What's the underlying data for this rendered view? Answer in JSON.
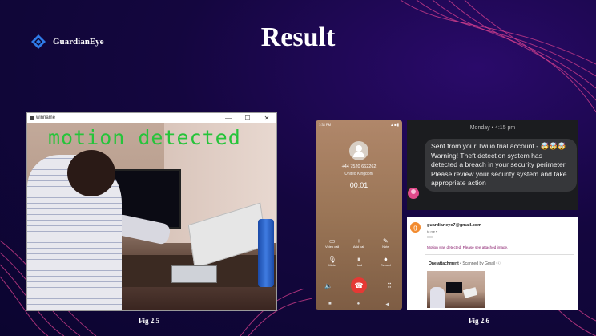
{
  "brand": {
    "name": "GuardianEye",
    "color": "#2f7be8"
  },
  "slide": {
    "title": "Result"
  },
  "fig25": {
    "caption": "Fig 2.5",
    "window_title": "winname",
    "overlay_text": "motion detected",
    "overlay_color": "#26c43a",
    "window_controls": {
      "minimize": "—",
      "maximize": "☐",
      "close": "✕"
    }
  },
  "fig26": {
    "caption": "Fig 2.6",
    "call": {
      "status_time": "1:34 PM",
      "status_icons": "▲ ■ ▮",
      "number": "+44 7520 662262",
      "country": "United Kingdom",
      "timer": "00:01",
      "buttons": [
        {
          "icon": "video-icon",
          "glyph": "▭",
          "label": "Video call"
        },
        {
          "icon": "add-call-icon",
          "glyph": "+",
          "label": "Add call"
        },
        {
          "icon": "note-icon",
          "glyph": "✎",
          "label": "Note"
        },
        {
          "icon": "mute-icon",
          "glyph": "🎙",
          "label": "Mute"
        },
        {
          "icon": "hold-icon",
          "glyph": "⏸",
          "label": "Hold"
        },
        {
          "icon": "record-icon",
          "glyph": "⏺",
          "label": "Record"
        }
      ],
      "speaker_glyph": "🔈",
      "hangup_glyph": "☎",
      "keypad_glyph": "⠿",
      "nav": [
        "■",
        "●",
        "◀"
      ],
      "hangup_color": "#e53935"
    },
    "sms": {
      "time": "Monday • 4:15 pm",
      "message": "Sent from your Twilio trial account - 🤯🤯🤯Warning! Theft detection system has detected a breach in your security perimeter. Please review your security system and take appropriate action"
    },
    "email": {
      "avatar_letter": "g",
      "sender": "guardianeye7@gmail.com",
      "to": "to me ▾",
      "body": "Motion was detected. Please see attached image.",
      "attachment_title": "One attachment",
      "attachment_scan": " • Scanned by Gmail ⓘ"
    }
  }
}
